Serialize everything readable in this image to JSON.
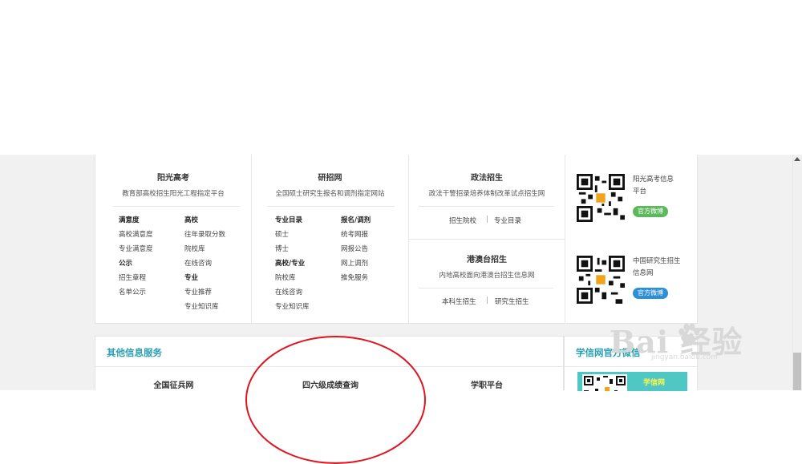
{
  "col1": {
    "title": "阳光高考",
    "subtitle": "教育部高校招生阳光工程指定平台",
    "left": [
      {
        "text": "满意度",
        "bold": true
      },
      {
        "text": "高校满意度"
      },
      {
        "text": "专业满意度"
      },
      {
        "text": "公示",
        "bold": true
      },
      {
        "text": "招生章程"
      },
      {
        "text": "名单公示"
      }
    ],
    "right": [
      {
        "text": "高校",
        "bold": true
      },
      {
        "text": "往年录取分数"
      },
      {
        "text": "院校库"
      },
      {
        "text": "在线咨询"
      },
      {
        "text": "专业",
        "bold": true
      },
      {
        "text": "专业推荐"
      },
      {
        "text": "专业知识库"
      }
    ]
  },
  "col2": {
    "title": "研招网",
    "subtitle": "全国硕士研究生报名和调剂指定网站",
    "left": [
      {
        "text": "专业目录",
        "bold": true
      },
      {
        "text": "硕士"
      },
      {
        "text": "博士"
      },
      {
        "text": "高校/专业",
        "bold": true
      },
      {
        "text": "院校库"
      },
      {
        "text": "在线咨询"
      },
      {
        "text": "专业知识库"
      }
    ],
    "right": [
      {
        "text": "报名/调剂",
        "bold": true
      },
      {
        "text": "统考网报"
      },
      {
        "text": "网报公告"
      },
      {
        "text": "网上调剂"
      },
      {
        "text": "推免服务"
      }
    ]
  },
  "col3a": {
    "title": "政法招生",
    "subtitle": "政法干警招录培养体制改革试点招生网",
    "link1": "招生院校",
    "link2": "专业目录",
    "pipe": "|"
  },
  "col3b": {
    "title": "港澳台招生",
    "subtitle": "内地高校面向港澳台招生信息网",
    "link1": "本科生招生",
    "link2": "研究生招生",
    "pipe": "|"
  },
  "social": [
    {
      "name_line1": "阳光高考信息",
      "name_line2": "平台",
      "badge": "官方微博",
      "badge_color": "#5cb85c"
    },
    {
      "name_line1": "中国研究生招生",
      "name_line2": "信息网",
      "badge": "官方微博",
      "badge_color": "#2d8fd5"
    }
  ],
  "other_services": {
    "title": "其他信息服务",
    "items": [
      "全国征兵网",
      "四六级成绩查询",
      "学职平台"
    ]
  },
  "wechat": {
    "title": "学信网官方微信",
    "thumb_label": "学信网"
  },
  "watermark": {
    "text": "Bai 经验",
    "sub": "jingyan.baidu.com"
  },
  "colors": {
    "accent": "#2a9fb3",
    "annotation": "#e0141e"
  }
}
